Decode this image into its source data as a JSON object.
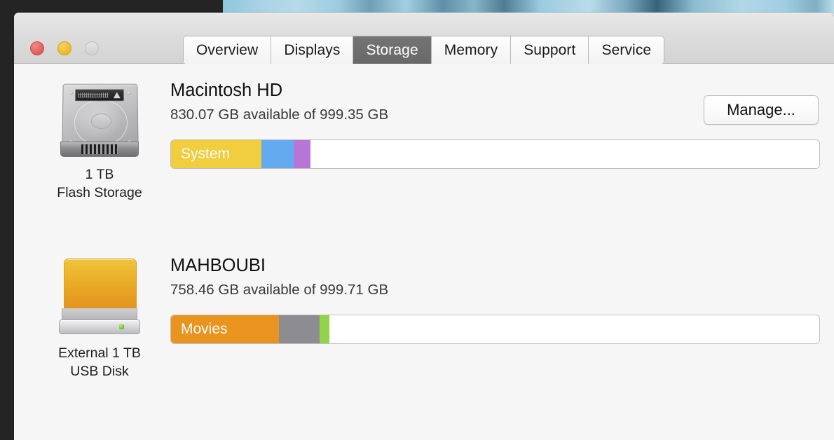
{
  "window": {
    "traffic_lights": [
      {
        "name": "close",
        "color": "#e05b57"
      },
      {
        "name": "minimize",
        "color": "#edb922"
      },
      {
        "name": "zoom",
        "color": "#d2d2d2"
      }
    ],
    "tabs": [
      {
        "label": "Overview",
        "selected": false
      },
      {
        "label": "Displays",
        "selected": false
      },
      {
        "label": "Storage",
        "selected": true
      },
      {
        "label": "Memory",
        "selected": false
      },
      {
        "label": "Support",
        "selected": false
      },
      {
        "label": "Service",
        "selected": false
      }
    ]
  },
  "volumes": [
    {
      "icon": "internal-hard-drive-icon",
      "caption_line1": "1 TB",
      "caption_line2": "Flash Storage",
      "name": "Macintosh HD",
      "available_text": "830.07 GB available of 999.35 GB",
      "available_gb": 830.07,
      "capacity_gb": 999.35,
      "manage_button": "Manage...",
      "segments": [
        {
          "label": "System",
          "color": "#f0ce3e",
          "percent": 13.9
        },
        {
          "label": "",
          "color": "#63aaef",
          "percent": 5.0
        },
        {
          "label": "",
          "color": "#b775d8",
          "percent": 2.6
        },
        {
          "label": "",
          "color": "#ffffff",
          "percent": 78.5
        }
      ]
    },
    {
      "icon": "external-usb-drive-icon",
      "caption_line1": "External 1 TB",
      "caption_line2": "USB Disk",
      "name": "MAHBOUBI",
      "available_text": "758.46 GB available of 999.71 GB",
      "available_gb": 758.46,
      "capacity_gb": 999.71,
      "manage_button": null,
      "segments": [
        {
          "label": "Movies",
          "color": "#e8941f",
          "percent": 16.7
        },
        {
          "label": "",
          "color": "#8d8d91",
          "percent": 6.2
        },
        {
          "label": "",
          "color": "#8fd44a",
          "percent": 1.5
        },
        {
          "label": "",
          "color": "#ffffff",
          "percent": 75.6
        }
      ]
    }
  ]
}
